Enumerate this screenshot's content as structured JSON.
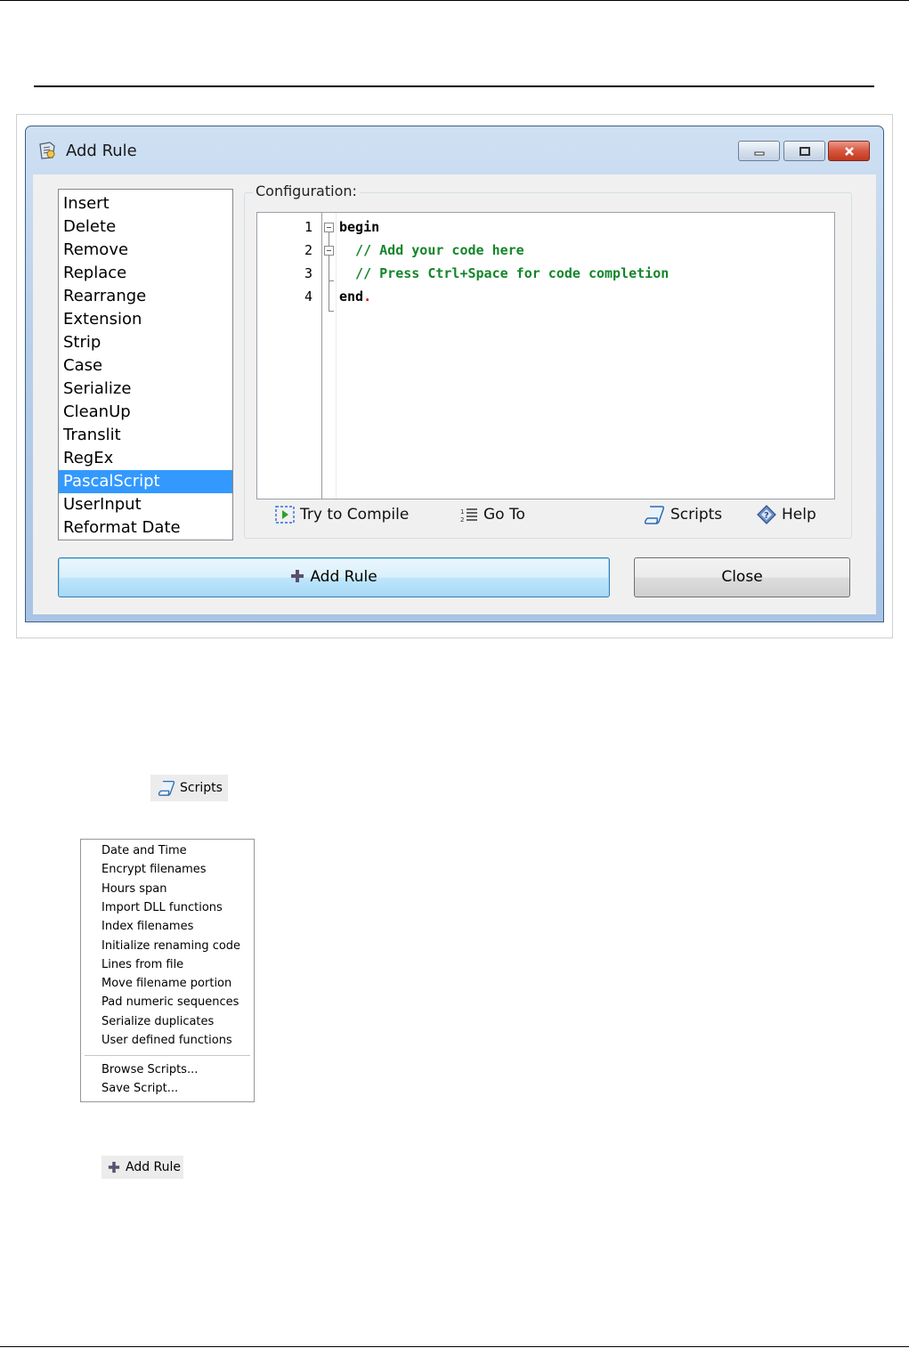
{
  "window": {
    "title": "Add Rule"
  },
  "rules_list": {
    "items": [
      "Insert",
      "Delete",
      "Remove",
      "Replace",
      "Rearrange",
      "Extension",
      "Strip",
      "Case",
      "Serialize",
      "CleanUp",
      "Translit",
      "RegEx",
      "PascalScript",
      "UserInput",
      "Reformat Date"
    ],
    "selected": "PascalScript"
  },
  "configuration": {
    "label": "Configuration:",
    "code_lines": [
      {
        "number": "1",
        "text": "begin"
      },
      {
        "number": "2",
        "text": "  // Add your code here"
      },
      {
        "number": "3",
        "text": "  // Press Ctrl+Space for code completion"
      },
      {
        "number": "4",
        "text": "end"
      }
    ],
    "end_dot": "."
  },
  "toolbar": {
    "compile": "Try to Compile",
    "goto": "Go To",
    "scripts": "Scripts",
    "help": "Help"
  },
  "buttons": {
    "add_rule": "Add Rule",
    "close": "Close"
  },
  "scripts_snippet": {
    "label": "Scripts"
  },
  "scripts_menu": {
    "items": [
      "Date and Time",
      "Encrypt filenames",
      "Hours span",
      "Import DLL functions",
      "Index filenames",
      "Initialize renaming code",
      "Lines from file",
      "Move filename portion",
      "Pad numeric sequences",
      "Serialize duplicates",
      "User defined functions"
    ],
    "extra_items": [
      "Browse Scripts...",
      "Save Script..."
    ]
  },
  "add_rule_snippet": {
    "label": "Add Rule"
  },
  "colors": {
    "selection": "#3399ff",
    "comment": "#14862a",
    "punctuation": "#d01010"
  }
}
